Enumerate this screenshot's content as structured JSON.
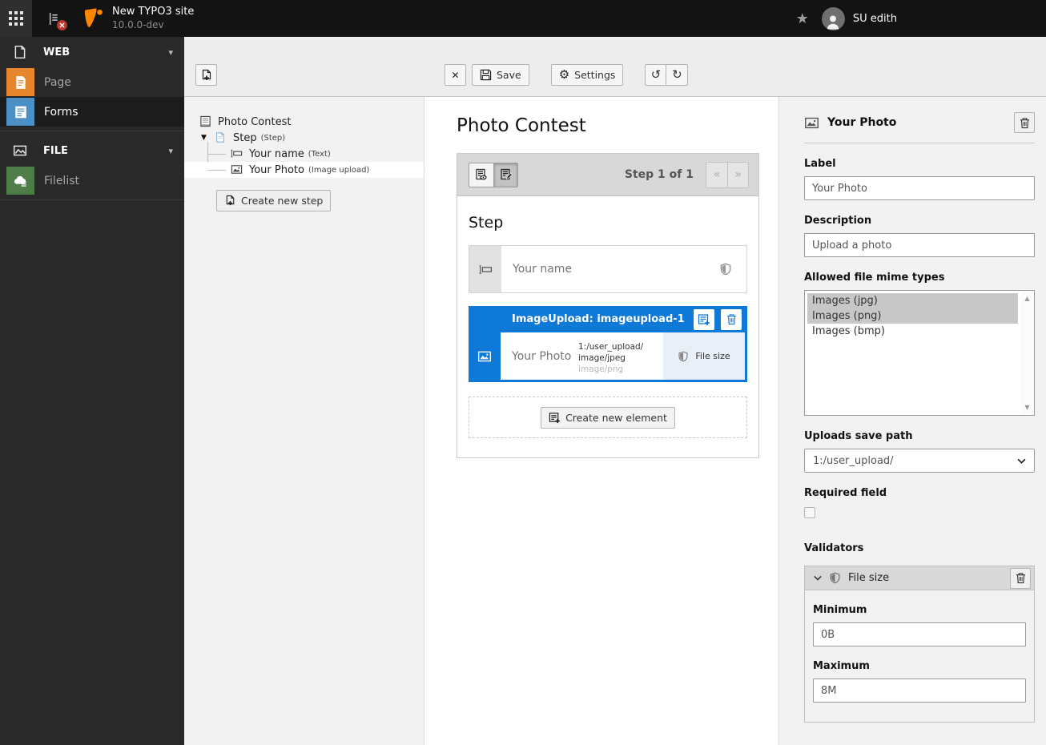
{
  "topbar": {
    "site_title": "New TYPO3 site",
    "site_version": "10.0.0-dev",
    "username": "SU edith"
  },
  "sidebar": {
    "web_section": "WEB",
    "file_section": "FILE",
    "page_label": "Page",
    "forms_label": "Forms",
    "filelist_label": "Filelist"
  },
  "toolbar": {
    "save_label": "Save",
    "settings_label": "Settings"
  },
  "tree": {
    "root_label": "Photo Contest",
    "step_label": "Step",
    "step_type": "(Step)",
    "name_label": "Your name",
    "name_type": "(Text)",
    "photo_label": "Your Photo",
    "photo_type": "(Image upload)",
    "create_step_label": "Create new step"
  },
  "stage": {
    "form_title": "Photo Contest",
    "pagination_label": "Step 1 of 1",
    "step_heading": "Step",
    "text_element_label": "Your name",
    "selected_element": {
      "header": "ImageUpload: imageupload-1",
      "label": "Your Photo",
      "meta_line1": "1:/user_upload/",
      "meta_line2": "image/jpeg",
      "meta_line3": "image/png",
      "validator_badge": "File size"
    },
    "create_element_label": "Create new element"
  },
  "inspector": {
    "title": "Your Photo",
    "label_field": {
      "label": "Label",
      "value": "Your Photo"
    },
    "description_field": {
      "label": "Description",
      "value": "Upload a photo"
    },
    "mime_field": {
      "label": "Allowed file mime types",
      "options": [
        {
          "label": "Images (jpg)",
          "selected": true
        },
        {
          "label": "Images (png)",
          "selected": true
        },
        {
          "label": "Images (bmp)",
          "selected": false
        }
      ]
    },
    "save_path_field": {
      "label": "Uploads save path",
      "value": "1:/user_upload/"
    },
    "required_field": {
      "label": "Required field",
      "checked": false
    },
    "validators_label": "Validators",
    "validator": {
      "title": "File size",
      "minimum": {
        "label": "Minimum",
        "value": "0B"
      },
      "maximum": {
        "label": "Maximum",
        "value": "8M"
      }
    }
  },
  "icons": {
    "close": "✕",
    "gear": "⚙",
    "undo": "↺",
    "redo": "↻",
    "prev": "«",
    "next": "»",
    "star": "★",
    "chevron_down": "▾",
    "tree_expand": "▼",
    "scroll_up": "▲",
    "scroll_down": "▼"
  },
  "colors": {
    "accent_blue": "#0e79d7",
    "brand_orange": "#ff8700",
    "module_page": "#e8862d",
    "module_forms": "#4c8fc4",
    "module_filelist": "#4f7d4a"
  }
}
